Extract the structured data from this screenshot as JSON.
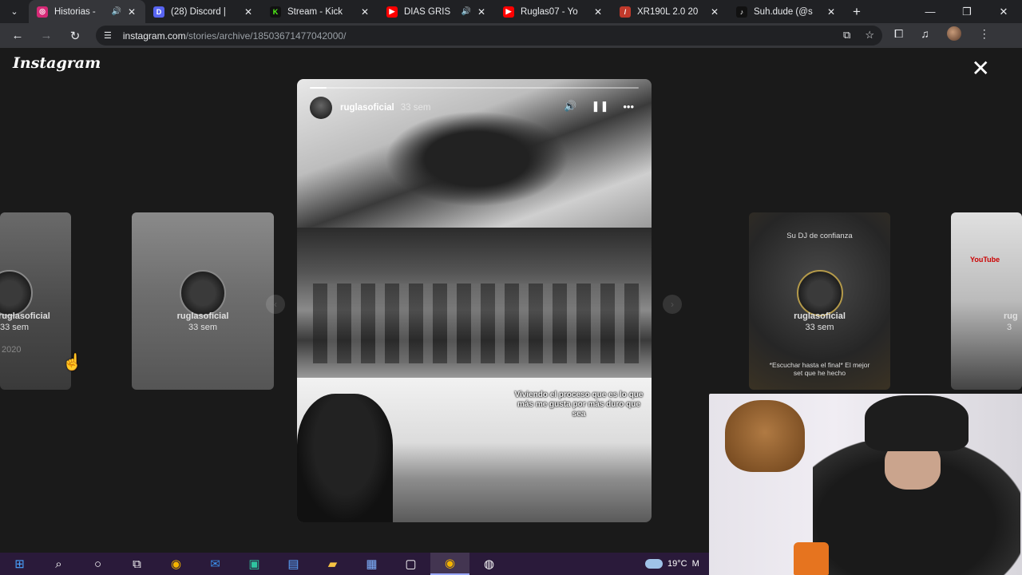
{
  "browser": {
    "tabs": [
      {
        "title": "Historias -",
        "favicon": "instagram-icon",
        "color": "#d62976",
        "audio": true,
        "active": true
      },
      {
        "title": "(28) Discord |",
        "favicon": "discord-icon",
        "color": "#5865f2",
        "audio": false,
        "active": false
      },
      {
        "title": "Stream - Kick",
        "favicon": "kick-icon",
        "color": "#53fc18",
        "audio": false,
        "active": false
      },
      {
        "title": "DIAS GRIS",
        "favicon": "youtube-icon",
        "color": "#ff0000",
        "audio": true,
        "active": false
      },
      {
        "title": "Ruglas07 - Yo",
        "favicon": "youtube-icon",
        "color": "#ff0000",
        "audio": false,
        "active": false
      },
      {
        "title": "XR190L 2.0 20",
        "favicon": "moto-icon",
        "color": "#c0392b",
        "audio": false,
        "active": false
      },
      {
        "title": "Suh.dude (@s",
        "favicon": "tiktok-icon",
        "color": "#111111",
        "audio": false,
        "active": false
      }
    ],
    "url_host": "instagram.com",
    "url_path": "/stories/archive/18503671477042000/"
  },
  "viewer": {
    "logo": "Instagram",
    "close_symbol": "✕",
    "story": {
      "username": "ruglasoficial",
      "time": "33 sem",
      "progress": 0.05,
      "caption": "Viviendo el proceso que es lo que más me gusta por más duro que sea"
    },
    "previews": [
      {
        "name": "ruglasoficial",
        "time": "33 sem",
        "overlay_top": "",
        "overlay_bottom": "",
        "extra": "2020"
      },
      {
        "name": "ruglasoficial",
        "time": "33 sem",
        "overlay_top": "",
        "overlay_bottom": "",
        "extra": ""
      },
      {
        "name": "ruglasoficial",
        "time": "33 sem",
        "overlay_top": "Su DJ de confianza",
        "overlay_bottom": "*Escuchar hasta el final* El mejor set que he hecho",
        "extra": ""
      },
      {
        "name": "rug",
        "time": "3",
        "overlay_top": "YouTube",
        "overlay_bottom": "",
        "extra": ""
      }
    ]
  },
  "taskbar": {
    "items": [
      "windows-icon",
      "search-icon",
      "cortana-icon",
      "task-view-icon",
      "chrome-icon",
      "mail-icon",
      "app-icon",
      "store-icon",
      "explorer-icon",
      "calendar-icon",
      "chat-icon",
      "chrome-active-icon",
      "obs-icon"
    ],
    "temperature": "19°C",
    "weather_extra": "M"
  }
}
